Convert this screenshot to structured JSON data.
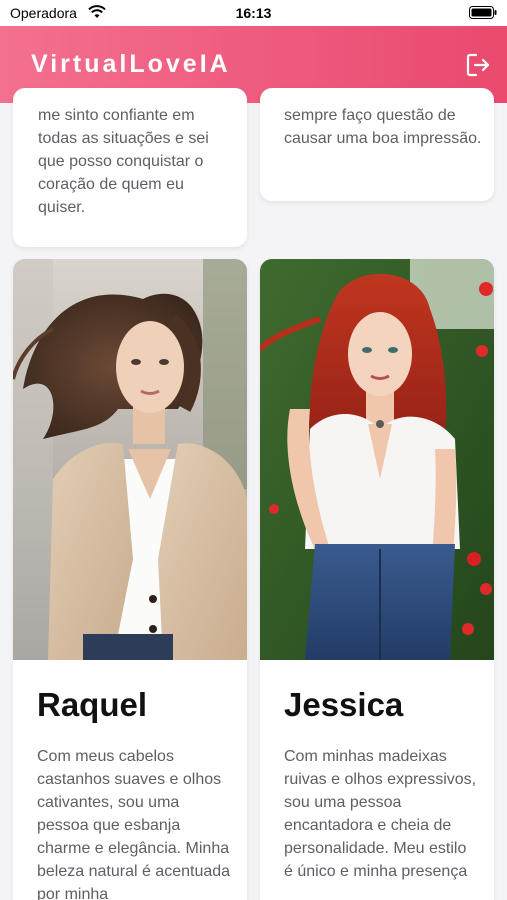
{
  "status": {
    "carrier": "Operadora",
    "time": "16:13"
  },
  "header": {
    "title": "VirtualLoveIA",
    "logout_icon": "logout-icon"
  },
  "cards": [
    {
      "text": "me sinto confiante em todas as situações e sei que posso conquistar o coração de quem eu quiser."
    },
    {
      "text": "sempre faço questão de causar uma boa impressão."
    },
    {
      "name": "Raquel",
      "description": "Com meus cabelos castanhos suaves e olhos cativantes, sou uma pessoa que esbanja charme e elegância. Minha beleza natural é acentuada por minha",
      "photo": "portrait-photo"
    },
    {
      "name": "Jessica",
      "description": "Com minhas madeixas ruivas e olhos expressivos, sou uma pessoa encantadora e cheia de personalidade. Meu estilo é único e minha presença",
      "photo": "portrait-photo"
    }
  ],
  "colors": {
    "header_start": "#f4708f",
    "header_end": "#e94a6e",
    "card_text": "#5e5e66",
    "name_text": "#111111"
  }
}
